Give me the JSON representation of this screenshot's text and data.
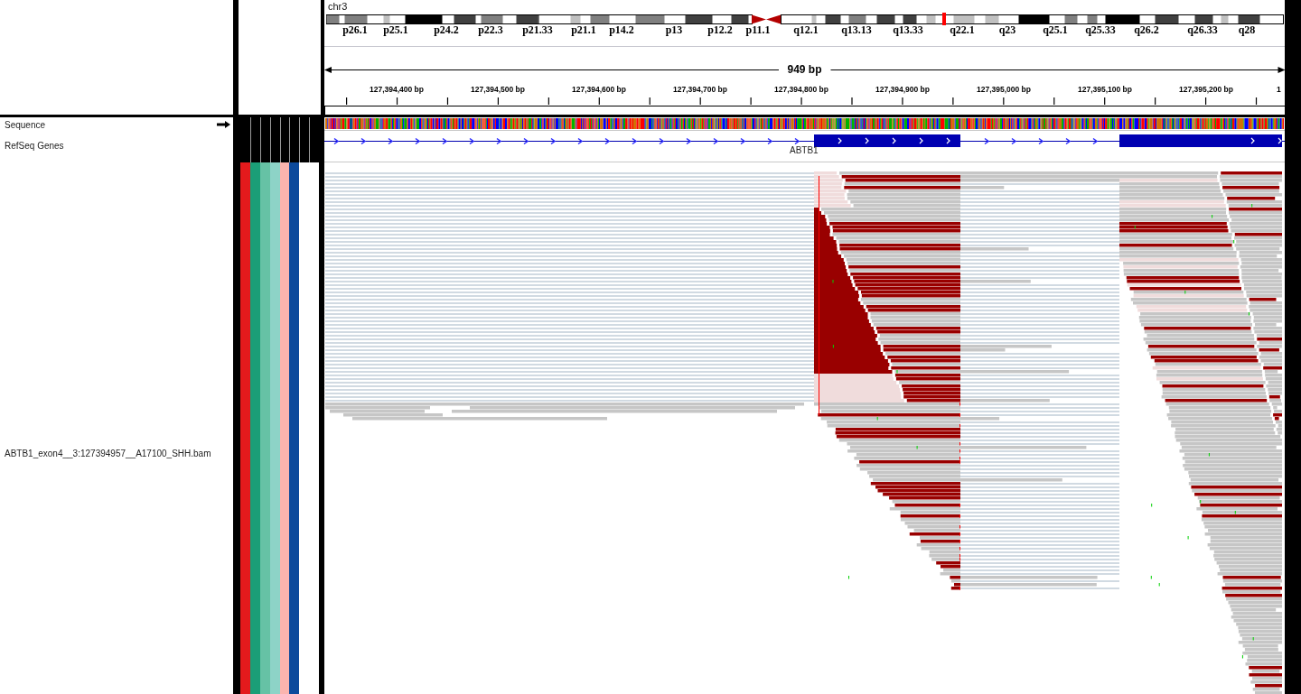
{
  "header": {
    "chromosome": "chr3",
    "cytobands": [
      "p26.1",
      "p25.1",
      "p24.2",
      "p22.3",
      "p21.33",
      "p21.1",
      "p14.2",
      "p13",
      "p12.2",
      "p11.1",
      "q12.1",
      "q13.13",
      "q13.33",
      "q22.1",
      "q23",
      "q25.1",
      "q25.33",
      "q26.2",
      "q26.33",
      "q28"
    ],
    "span": "949 bp",
    "ticks": [
      "127,394,400 bp",
      "127,394,500 bp",
      "127,394,600 bp",
      "127,394,700 bp",
      "127,394,800 bp",
      "127,394,900 bp",
      "127,395,000 bp",
      "127,395,100 bp",
      "127,395,200 bp",
      "1"
    ]
  },
  "attributes": [
    {
      "color": "#e41a1c"
    },
    {
      "color": "#1b9e77"
    },
    {
      "color": "#66c2a5"
    },
    {
      "color": "#8dd3c7"
    },
    {
      "color": "#fbb4ae"
    },
    {
      "color": "#0c4a9c"
    },
    {
      "color": "#ffffff"
    },
    {
      "color": "#ffffff"
    }
  ],
  "tracks": [
    {
      "kind": "sequence",
      "name": "Sequence"
    },
    {
      "kind": "genes",
      "name": "RefSeq Genes",
      "gene": "ABTB1"
    },
    {
      "kind": "alignment",
      "name": "ABTB1_exon4__3:127394957__A17100_SHH.bam"
    }
  ]
}
